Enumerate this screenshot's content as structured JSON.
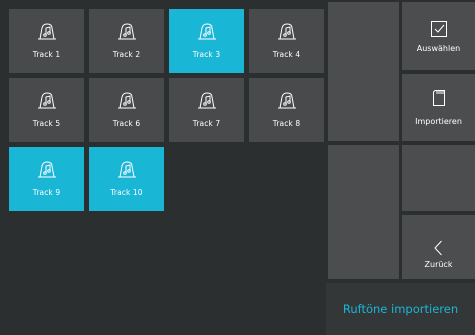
{
  "tracks": [
    {
      "label": "Track 1",
      "selected": false
    },
    {
      "label": "Track 2",
      "selected": false
    },
    {
      "label": "Track 3",
      "selected": true
    },
    {
      "label": "Track 4",
      "selected": false
    },
    {
      "label": "Track 5",
      "selected": false
    },
    {
      "label": "Track 6",
      "selected": false
    },
    {
      "label": "Track 7",
      "selected": false
    },
    {
      "label": "Track 8",
      "selected": false
    },
    {
      "label": "Track 9",
      "selected": true
    },
    {
      "label": "Track 10",
      "selected": true
    }
  ],
  "sidebar": {
    "select_label": "Auswählen",
    "import_label": "Importieren",
    "back_label": "Zurück",
    "footer_title": "Ruftöne importieren"
  },
  "colors": {
    "accent": "#1ab6d6",
    "tile": "#484a4b",
    "background": "#2c2f30"
  },
  "icons": {
    "track": "ringtone-bell-note-icon",
    "select": "checkbox-icon",
    "import": "sd-card-icon",
    "back": "chevron-left-icon"
  }
}
